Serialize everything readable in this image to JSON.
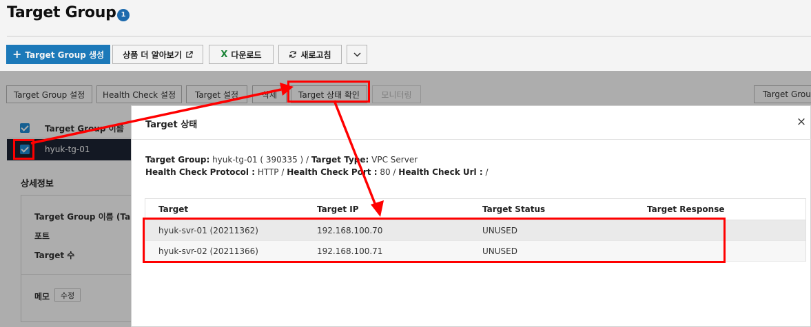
{
  "page": {
    "title": "Target Group",
    "badge": "1"
  },
  "toolbar": {
    "create_label": "Target Group 생성",
    "learn_more_label": "상품 더 알아보기",
    "download_label": "다운로드",
    "refresh_label": "새로고침"
  },
  "tabs": [
    {
      "label": "Target Group 설정"
    },
    {
      "label": "Health Check 설정"
    },
    {
      "label": "Target 설정"
    },
    {
      "label": "삭제"
    },
    {
      "label": "Target 상태 확인"
    },
    {
      "label": "모니터링"
    },
    {
      "label": "Target Group"
    }
  ],
  "list": {
    "header": "Target Group 이름",
    "rows": [
      {
        "name": "hyuk-tg-01"
      }
    ]
  },
  "detail": {
    "title": "상세정보",
    "labels": [
      "Target Group 이름 (TargetG",
      "포트",
      "Target 수"
    ],
    "memo_label": "메모",
    "memo_edit": "수정"
  },
  "modal": {
    "title": "Target 상태",
    "close_symbol": "×",
    "info": {
      "target_group_label": "Target Group:",
      "target_group_value": "hyuk-tg-01 ( 390335 ) / ",
      "target_type_label": "Target Type:",
      "target_type_value": "VPC Server",
      "protocol_label": "Health Check Protocol :",
      "protocol_value": "HTTP / ",
      "port_label": "Health Check Port :",
      "port_value": "80 / ",
      "url_label": "Health Check Url :",
      "url_value": "/"
    },
    "table": {
      "columns": [
        "Target",
        "Target IP",
        "Target Status",
        "Target Response"
      ],
      "rows": [
        {
          "target": "hyuk-svr-01 (20211362)",
          "ip": "192.168.100.70",
          "status": "UNUSED",
          "response": ""
        },
        {
          "target": "hyuk-svr-02 (20211366)",
          "ip": "192.168.100.71",
          "status": "UNUSED",
          "response": ""
        }
      ]
    }
  },
  "colors": {
    "primary": "#1e7fc2",
    "annotation": "#ff0000",
    "selected_row": "#1c2434",
    "checkbox": "#1f8dd6"
  }
}
